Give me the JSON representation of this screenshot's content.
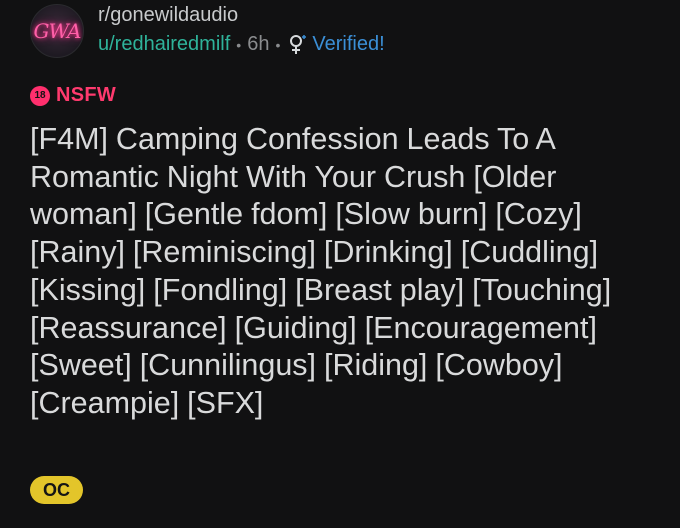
{
  "post": {
    "subreddit": "r/gonewildaudio",
    "author": "u/redhairedmilf",
    "separator": "•",
    "age": "6h",
    "verified_label": "Verified!",
    "avatar_text": "GWA",
    "nsfw_badge_icon_text": "18",
    "nsfw_label": "NSFW",
    "title": "[F4M] Camping Confession Leads To A Romantic Night With Your Crush [Older woman] [Gentle fdom] [Slow burn] [Cozy] [Rainy] [Reminiscing] [Drinking] [Cuddling] [Kissing] [Fondling] [Breast play] [Touching] [Reassurance] [Guiding] [Encouragement] [Sweet] [Cunnilingus] [Riding] [Cowboy] [Creampie] [SFX]",
    "flair": "OC"
  },
  "colors": {
    "background": "#111112",
    "username": "#2fb39a",
    "verified": "#3b8fd6",
    "nsfw": "#ff3a6e",
    "flair_bg": "#e3c52a"
  },
  "icons": {
    "verified": "female-symbol-icon",
    "nsfw": "nsfw-18-icon",
    "avatar": "subreddit-avatar"
  }
}
